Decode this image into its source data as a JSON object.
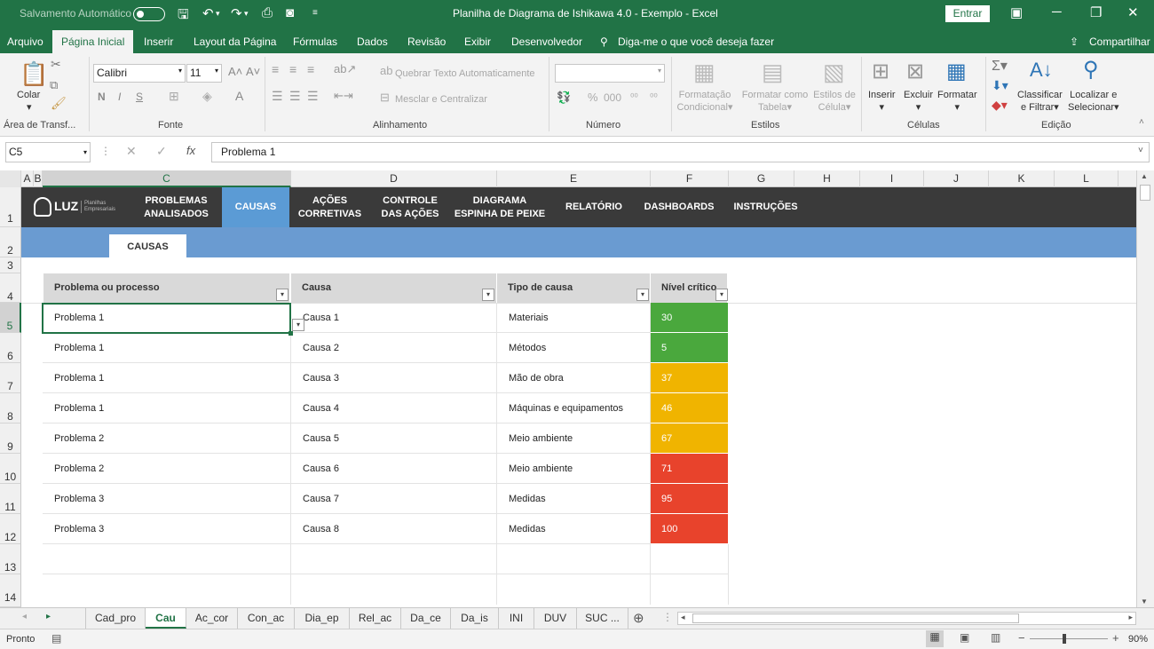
{
  "window": {
    "autosave_label": "Salvamento Automático",
    "title": "Planilha de Diagrama de Ishikawa 4.0 - Exemplo  -  Excel",
    "signin_label": "Entrar"
  },
  "menu": {
    "tabs": [
      "Arquivo",
      "Página Inicial",
      "Inserir",
      "Layout da Página",
      "Fórmulas",
      "Dados",
      "Revisão",
      "Exibir",
      "Desenvolvedor"
    ],
    "tell_me": "Diga-me o que você deseja fazer",
    "share": "Compartilhar"
  },
  "ribbon": {
    "paste_label": "Colar",
    "clipboard_group": "Área de Transf...",
    "font_name": "Calibri",
    "font_size": "11",
    "font_group": "Fonte",
    "wrap_text": "Quebrar Texto Automaticamente",
    "merge_center": "Mesclar e Centralizar",
    "alignment_group": "Alinhamento",
    "number_group": "Número",
    "cond_format_1": "Formatação",
    "cond_format_2": "Condicional",
    "format_table_1": "Formatar como",
    "format_table_2": "Tabela",
    "cell_styles_1": "Estilos de",
    "cell_styles_2": "Célula",
    "styles_group": "Estilos",
    "insert": "Inserir",
    "delete": "Excluir",
    "format": "Formatar",
    "cells_group": "Células",
    "sort_1": "Classificar",
    "sort_2": "e Filtrar",
    "find_1": "Localizar e",
    "find_2": "Selecionar",
    "editing_group": "Edição"
  },
  "formula_bar": {
    "name_box": "C5",
    "value": "Problema 1"
  },
  "columns": [
    "A",
    "B",
    "C",
    "D",
    "E",
    "F",
    "G",
    "H",
    "I",
    "J",
    "K",
    "L"
  ],
  "rows": [
    "1",
    "2",
    "3",
    "4",
    "5",
    "6",
    "7",
    "8",
    "9",
    "10",
    "11",
    "12",
    "13",
    "14"
  ],
  "logo": {
    "text": "LUZ",
    "sub": "Planilhas Empresariais"
  },
  "nav": [
    {
      "line1": "PROBLEMAS",
      "line2": "ANALISADOS"
    },
    {
      "line1": "CAUSAS",
      "line2": ""
    },
    {
      "line1": "AÇÕES",
      "line2": "CORRETIVAS"
    },
    {
      "line1": "CONTROLE",
      "line2": "DAS AÇÕES"
    },
    {
      "line1": "DIAGRAMA",
      "line2": "ESPINHA DE PEIXE"
    },
    {
      "line1": "RELATÓRIO",
      "line2": ""
    },
    {
      "line1": "DASHBOARDS",
      "line2": ""
    },
    {
      "line1": "INSTRUÇÕES",
      "line2": ""
    }
  ],
  "subtab": "CAUSAS",
  "table": {
    "headers": [
      "Problema ou processo",
      "Causa",
      "Tipo de causa",
      "Nível crítico"
    ],
    "rows": [
      {
        "problem": "Problema 1",
        "cause": "Causa 1",
        "type": "Materiais",
        "level": "30",
        "color": "#4aa83d"
      },
      {
        "problem": "Problema 1",
        "cause": "Causa 2",
        "type": "Métodos",
        "level": "5",
        "color": "#4aa83d"
      },
      {
        "problem": "Problema 1",
        "cause": "Causa 3",
        "type": "Mão de obra",
        "level": "37",
        "color": "#f0b400"
      },
      {
        "problem": "Problema 1",
        "cause": "Causa 4",
        "type": "Máquinas e equipamentos",
        "level": "46",
        "color": "#f0b400"
      },
      {
        "problem": "Problema 2",
        "cause": "Causa 5",
        "type": "Meio ambiente",
        "level": "67",
        "color": "#f0b400"
      },
      {
        "problem": "Problema 2",
        "cause": "Causa 6",
        "type": "Meio ambiente",
        "level": "71",
        "color": "#e8432c"
      },
      {
        "problem": "Problema 3",
        "cause": "Causa 7",
        "type": "Medidas",
        "level": "95",
        "color": "#e8432c"
      },
      {
        "problem": "Problema 3",
        "cause": "Causa 8",
        "type": "Medidas",
        "level": "100",
        "color": "#e8432c"
      }
    ]
  },
  "sheet_tabs": [
    "Cad_pro",
    "Cau",
    "Ac_cor",
    "Con_ac",
    "Dia_ep",
    "Rel_ac",
    "Da_ce",
    "Da_is",
    "INI",
    "DUV",
    "SUC ..."
  ],
  "status": {
    "ready": "Pronto",
    "zoom": "90%"
  }
}
